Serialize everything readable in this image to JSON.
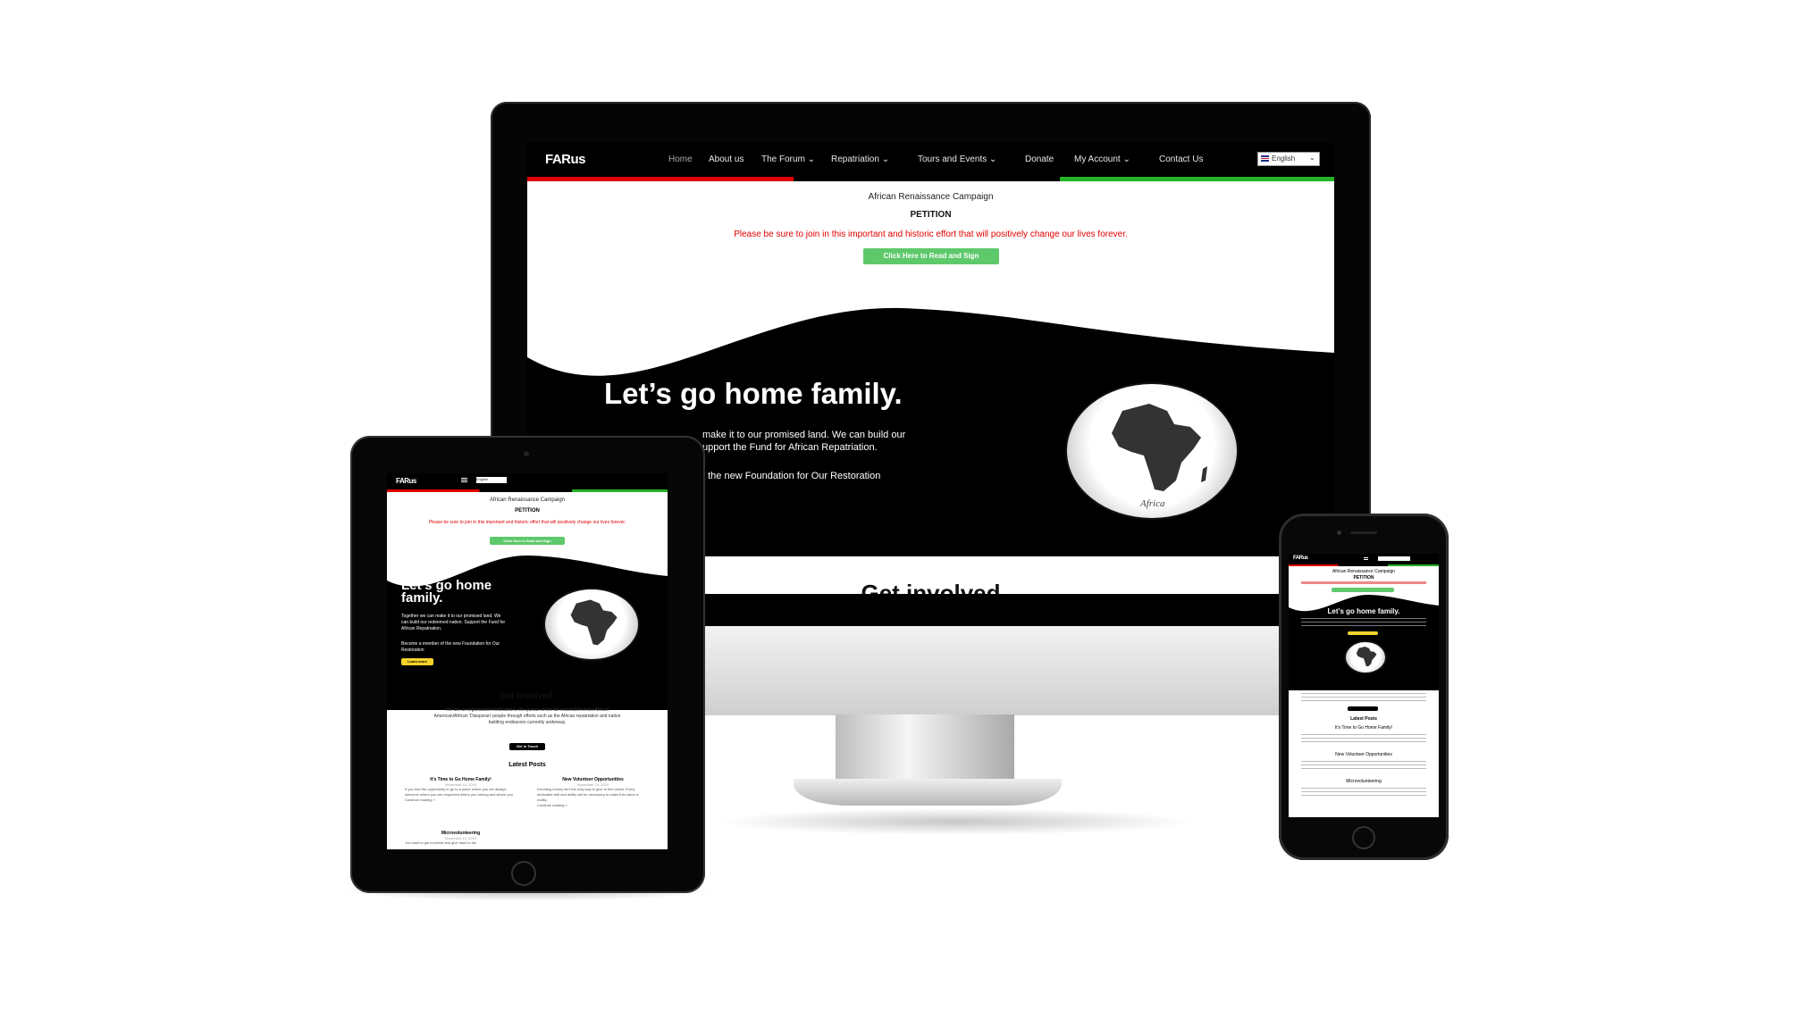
{
  "site": {
    "logo": "FARus",
    "nav": [
      "Home",
      "About us",
      "The Forum ⌄",
      "Repatriation ⌄",
      "Tours and Events ⌄",
      "Donate",
      "My Account ⌄",
      "Contact Us"
    ],
    "language": "English",
    "campaign": "African Renaissance Campaign",
    "petition": "PETITION",
    "notice": "Please be sure to join in this important and historic effort that will positively change our lives forever.",
    "sign_button": "Click Here to Read and Sign",
    "hero_title": "Let’s go home family.",
    "hero_title_short_1": "Let’s go home",
    "hero_title_short_2": "family.",
    "hero_line1": "make it to our promised land. We can build our",
    "hero_line2": "upport the Fund for African Repatriation.",
    "hero_line3": "f the new Foundation for Our Restoration",
    "tab_hero_text": "Together we can make it to our promised land. We can build our redeemed nation. Support the Fund for African Repatriation.",
    "tab_hero_text2": "Become a member of the new Foundation for Our Restoration",
    "learn_more": "Learn more",
    "globe_label": "Africa",
    "get_involved": "Get involved.",
    "get_involved_partial": "Get involved",
    "involved_text": "We are an organization dedicated to the pursuit of the full restoration of the African American/African 'Diasporan' people through efforts such as the African repatriation and nation building endeavors currently underway.",
    "get_in_touch": "Get in Touch",
    "latest_posts": "Latest Posts",
    "posts": [
      {
        "title": "It’s Time to Go Home Family!",
        "date": "November 14, 2019",
        "excerpt": "If you had the opportunity to go to a place where you are always welcome where you are respected where you belong and where you",
        "more": "Continue reading »"
      },
      {
        "title": "New Volunteer Opportunities",
        "date": "November 14, 2019",
        "excerpt": "Donating money isn't the only way to give to this cause. Every dedicated skill and ability will be necessary to make this vision a reality.",
        "more": "Continue reading »"
      },
      {
        "title": "Microvolunteering",
        "date": "November 14, 2019",
        "excerpt": "You want to get involved and give back to the",
        "more": "Continue reading »"
      }
    ]
  },
  "colors": {
    "red": "#e00000",
    "green": "#26b326",
    "button_green": "#5ec96b",
    "yellow": "#f4d22b"
  },
  "icons": {
    "hamburger": "menu-icon",
    "globe": "africa-globe-icon",
    "flag": "uk-flag-icon"
  }
}
